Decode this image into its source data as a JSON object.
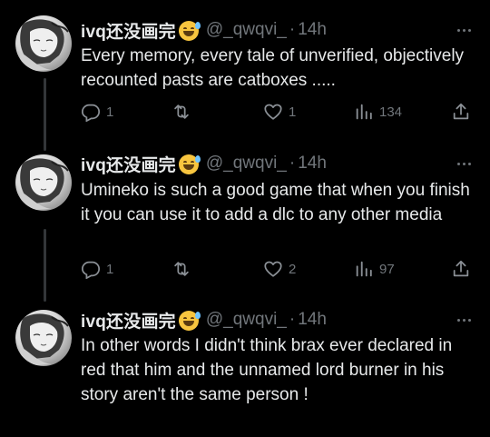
{
  "colors": {
    "background": "#000000",
    "text": "#e7e9ea",
    "muted": "#71767b",
    "thread_line": "#333639"
  },
  "tweets": [
    {
      "author": {
        "name": "ivq还没画完",
        "emoji": "grinning-face-with-sweat",
        "handle": "@_qwqvi_",
        "time": "14h"
      },
      "text": "Every memory, every tale of unverified, objectively recounted pasts are catboxes .....",
      "stats": {
        "replies": "1",
        "retweets": "",
        "likes": "1",
        "views": "134"
      }
    },
    {
      "author": {
        "name": "ivq还没画完",
        "emoji": "grinning-face-with-sweat",
        "handle": "@_qwqvi_",
        "time": "14h"
      },
      "text": "Umineko is such a good game that when you finish it you can use it to add a dlc to any other media",
      "stats": {
        "replies": "1",
        "retweets": "",
        "likes": "2",
        "views": "97"
      }
    },
    {
      "author": {
        "name": "ivq还没画完",
        "emoji": "grinning-face-with-sweat",
        "handle": "@_qwqvi_",
        "time": "14h"
      },
      "text": "In other words I didn't think brax ever declared in red that him and the unnamed lord burner in his story aren't the same person !",
      "stats": {
        "replies": "",
        "retweets": "",
        "likes": "",
        "views": ""
      }
    }
  ],
  "icons": {
    "reply": "reply-icon",
    "retweet": "retweet-icon",
    "like": "heart-icon",
    "views": "analytics-icon",
    "share": "share-icon",
    "more": "more-icon"
  },
  "misc": {
    "dot": "·"
  }
}
